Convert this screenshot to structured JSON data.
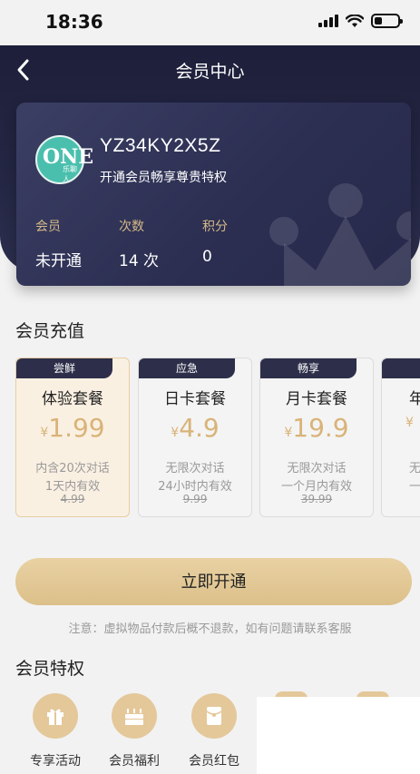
{
  "status_bar": {
    "time": "18:36"
  },
  "header": {
    "title": "会员中心"
  },
  "card": {
    "user_id": "YZ34KY2X5Z",
    "subtitle": "开通会员畅享尊贵特权",
    "logo_big": "ONE",
    "logo_small": "乐聊人",
    "stats": [
      {
        "label": "会员",
        "value": "未开通"
      },
      {
        "label": "次数",
        "value": "14 次"
      },
      {
        "label": "积分",
        "value": "0"
      }
    ]
  },
  "recharge": {
    "title": "会员充值",
    "currency": "¥",
    "packages": [
      {
        "tag": "尝鲜",
        "name": "体验套餐",
        "price": "1.99",
        "desc1": "内含20次对话",
        "desc2": "1天内有效",
        "original": "4.99",
        "selected": true
      },
      {
        "tag": "应急",
        "name": "日卡套餐",
        "price": "4.9",
        "desc1": "无限次对话",
        "desc2": "24小时内有效",
        "original": "9.99",
        "selected": false
      },
      {
        "tag": "畅享",
        "name": "月卡套餐",
        "price": "19.9",
        "desc1": "无限次对话",
        "desc2": "一个月内有效",
        "original": "39.99",
        "selected": false
      },
      {
        "tag": "",
        "name": "年",
        "price": "",
        "desc1": "无",
        "desc2": "一",
        "original": "",
        "selected": false
      }
    ]
  },
  "cta": {
    "label": "立即开通"
  },
  "notice": "注意：虚拟物品付款后概不退款，如有问题请联系客服",
  "privileges": {
    "title": "会员特权",
    "items": [
      {
        "label": "专享活动",
        "icon": "gift-icon"
      },
      {
        "label": "会员福利",
        "icon": "cake-icon"
      },
      {
        "label": "会员红包",
        "icon": "red-envelope-icon"
      }
    ]
  },
  "colors": {
    "accent": "#d9b378",
    "dark": "#2d2f4a",
    "cta": "#e2c795"
  }
}
